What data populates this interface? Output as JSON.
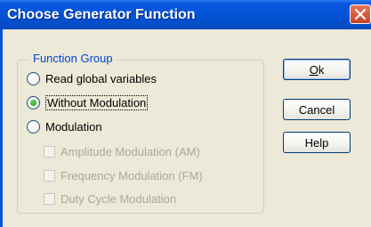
{
  "window": {
    "title": "Choose Generator Function"
  },
  "group": {
    "label": "Function Group"
  },
  "options": {
    "read_global": {
      "label": "Read global variables",
      "checked": false
    },
    "without_modulation": {
      "label": "Without Modulation",
      "checked": true
    },
    "modulation": {
      "label": "Modulation",
      "checked": false
    }
  },
  "modulation_types": {
    "am": {
      "label": "Amplitude Modulation (AM)",
      "checked": false,
      "enabled": false
    },
    "fm": {
      "label": "Frequency Modulation (FM)",
      "checked": false,
      "enabled": false
    },
    "duty": {
      "label": "Duty Cycle Modulation",
      "checked": false,
      "enabled": false
    }
  },
  "buttons": {
    "ok_first": "O",
    "ok_rest": "k",
    "cancel": "Cancel",
    "help": "Help"
  }
}
